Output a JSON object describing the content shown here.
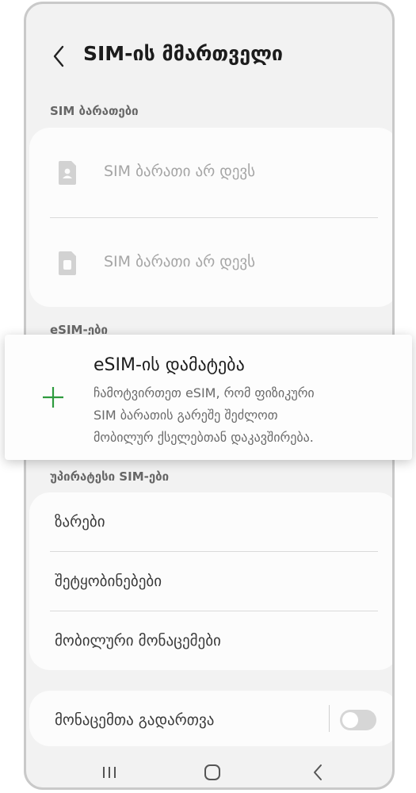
{
  "header": {
    "title": "SIM-ის მმართველი"
  },
  "sim_section": {
    "label": "SIM ბარათები",
    "items": [
      {
        "label": "SIM ბარათი არ დევს"
      },
      {
        "label": "SIM ბარათი არ დევს"
      }
    ]
  },
  "esim_section": {
    "label": "eSIM-ები"
  },
  "esim_popup": {
    "title": "eSIM-ის დამატება",
    "description": "ჩამოტვირთეთ eSIM, რომ ფიზიკური\nSIM ბარათის გარეშე შეძლოთ\nმობილურ ქსელებთან დაკავშირება."
  },
  "preferred_section": {
    "label": "უპირატესი SIM-ები",
    "items": [
      {
        "label": "ზარები"
      },
      {
        "label": "შეტყობინებები"
      },
      {
        "label": "მობილური მონაცემები"
      }
    ]
  },
  "data_switch": {
    "label": "მონაცემთა გადართვა",
    "enabled": false
  },
  "colors": {
    "accent_plus": "#2e9b3e",
    "toggle_off": "#d6d6d6"
  }
}
